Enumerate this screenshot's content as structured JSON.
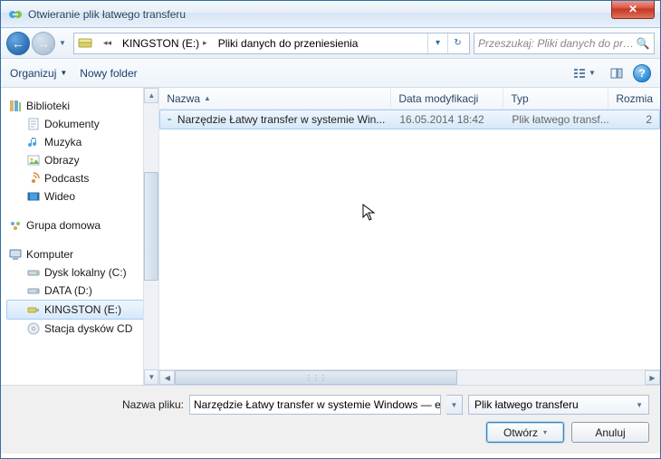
{
  "window": {
    "title": "Otwieranie plik łatwego transferu"
  },
  "breadcrumb": {
    "drive": "KINGSTON (E:)",
    "folder": "Pliki danych do przeniesienia"
  },
  "search": {
    "placeholder": "Przeszukaj: Pliki danych do prz..."
  },
  "toolbar": {
    "organize": "Organizuj",
    "new_folder": "Nowy folder"
  },
  "sidebar": {
    "libraries_label": "Biblioteki",
    "libraries": [
      {
        "label": "Dokumenty"
      },
      {
        "label": "Muzyka"
      },
      {
        "label": "Obrazy"
      },
      {
        "label": "Podcasts"
      },
      {
        "label": "Wideo"
      }
    ],
    "homegroup_label": "Grupa domowa",
    "computer_label": "Komputer",
    "drives": [
      {
        "label": "Dysk lokalny (C:)"
      },
      {
        "label": "DATA (D:)"
      },
      {
        "label": "KINGSTON (E:)",
        "selected": true
      },
      {
        "label": "Stacja dysków CD"
      }
    ]
  },
  "columns": {
    "name": "Nazwa",
    "modified": "Data modyfikacji",
    "type": "Typ",
    "size": "Rozmia"
  },
  "files": [
    {
      "name": "Narzędzie Łatwy transfer w systemie Win...",
      "modified": "16.05.2014 18:42",
      "type": "Plik łatwego transf...",
      "size": "2",
      "selected": true
    }
  ],
  "bottom": {
    "filename_label": "Nazwa pliku:",
    "filename_value": "Narzędzie Łatwy transfer w systemie Windows — ele",
    "filetype_value": "Plik łatwego transferu",
    "open": "Otwórz",
    "cancel": "Anuluj"
  }
}
